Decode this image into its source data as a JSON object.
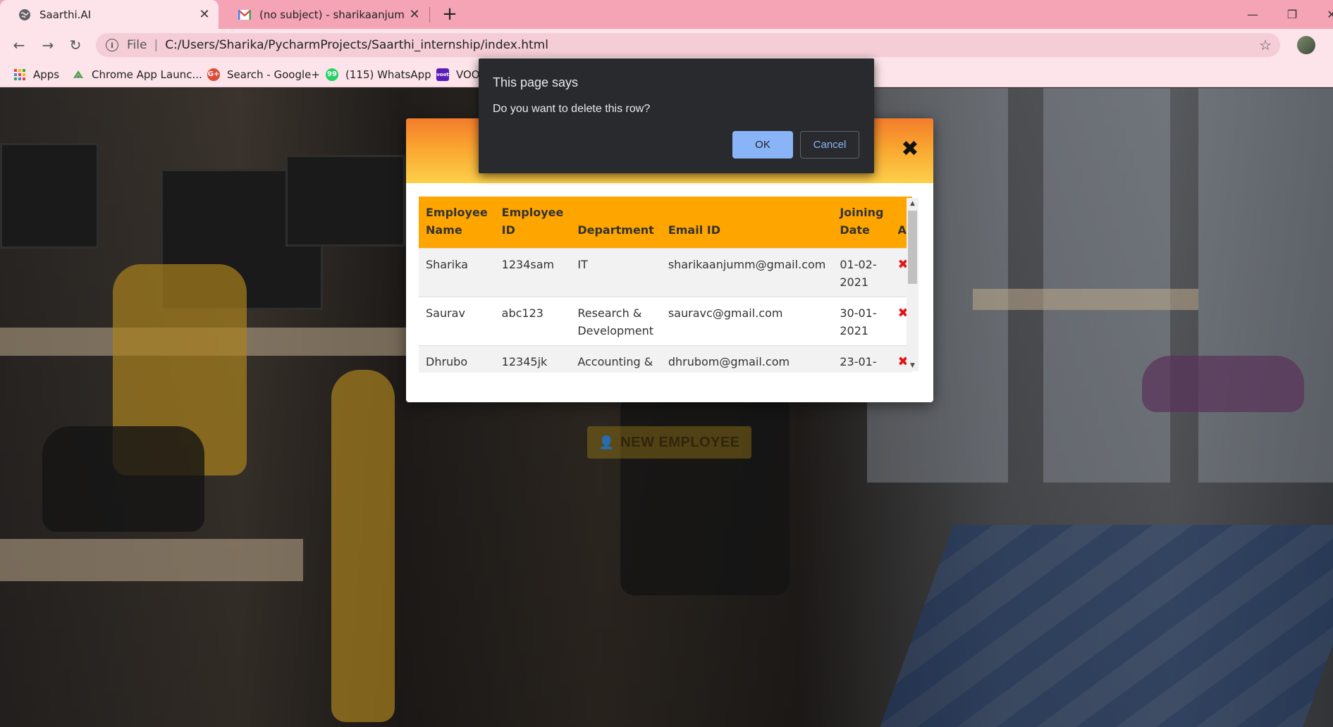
{
  "browser": {
    "tabs": [
      {
        "title": "Saarthi.AI",
        "active": true,
        "icon": "globe-icon"
      },
      {
        "title": "(no subject) - sharikaanjumm@gmail.com",
        "active": false,
        "icon": "gmail-icon"
      }
    ],
    "new_tab": "+",
    "address": {
      "scheme": "File",
      "url": "C:/Users/Sharika/PycharmProjects/Saarthi_internship/index.html"
    },
    "bookmarks": [
      {
        "label": "Apps",
        "icon": "apps-grid-icon"
      },
      {
        "label": "Chrome App Launc...",
        "icon": "chrome-launcher-icon"
      },
      {
        "label": "Search - Google+",
        "icon": "google-plus-icon"
      },
      {
        "label": "(115) WhatsApp",
        "icon": "whatsapp-icon"
      },
      {
        "label": "VOOT",
        "icon": "voot-icon"
      }
    ],
    "colors": {
      "chrome": "#f4a4b4",
      "toolbar": "#fce4ea"
    }
  },
  "background_button": {
    "label": "NEW EMPLOYEE",
    "icon": "add-user-icon"
  },
  "modal": {
    "close_symbol": "✖",
    "table": {
      "headers": [
        [
          "Employee",
          "Name"
        ],
        [
          "Employee",
          "ID"
        ],
        [
          "",
          "Department"
        ],
        [
          "",
          "Email ID"
        ],
        [
          "Joining",
          "Date"
        ],
        [
          "",
          "Action"
        ]
      ],
      "rows": [
        {
          "name": "Sharika",
          "id": "1234sam",
          "dept": [
            "IT",
            ""
          ],
          "email": "sharikaanjumm@gmail.com",
          "date": [
            "01-02-",
            "2021"
          ],
          "action": "✖"
        },
        {
          "name": "Saurav",
          "id": "abc123",
          "dept": [
            "Research &",
            "Development"
          ],
          "email": "sauravc@gmail.com",
          "date": [
            "30-01-",
            "2021"
          ],
          "action": "✖"
        },
        {
          "name": "Dhrubo",
          "id": "12345jk",
          "dept": [
            "Accounting &",
            ""
          ],
          "email": "dhrubom@gmail.com",
          "date": [
            "23-01-",
            ""
          ],
          "action": "✖"
        }
      ]
    },
    "colors": {
      "header_top": "#f47c2c",
      "header_bottom": "#fdd04a",
      "table_header": "#ffa500",
      "delete_icon": "#e3131b"
    }
  },
  "alert": {
    "title": "This page says",
    "message": "Do you want to delete this row?",
    "ok_label": "OK",
    "cancel_label": "Cancel",
    "colors": {
      "background": "#292a2d",
      "ok": "#8ab4f8"
    }
  }
}
